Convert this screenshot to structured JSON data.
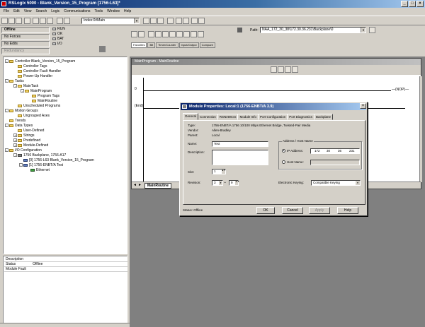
{
  "app": {
    "title": "RSLogix 5000 - Blank_Version_15_Program [1756-L63]*"
  },
  "menu": [
    "File",
    "Edit",
    "View",
    "Search",
    "Logic",
    "Communications",
    "Tools",
    "Window",
    "Help"
  ],
  "toolbar": {
    "routine_combo": "Index:0#Main",
    "path_label": "Path:",
    "path_value": "NAA_172_30_38\\172.30.36.231\\Backplane\\0"
  },
  "controller_status": {
    "mode": "Offline",
    "forces": "No Forces",
    "edits": "No Edits",
    "redundancy": "Redundancy",
    "leds": [
      "RUN",
      "OK",
      "BAT",
      "I/O"
    ]
  },
  "instruction_tabs": [
    "Favorites",
    "Bit",
    "Timer/Counter",
    "Input/Output",
    "Compare"
  ],
  "organizer": {
    "items": [
      {
        "label": "Controller Blank_Version_15_Program",
        "level": 0
      },
      {
        "label": "Controller Tags",
        "level": 1
      },
      {
        "label": "Controller Fault Handler",
        "level": 1
      },
      {
        "label": "Power-Up Handler",
        "level": 1
      },
      {
        "label": "Tasks",
        "level": 0
      },
      {
        "label": "MainTask",
        "level": 1
      },
      {
        "label": "MainProgram",
        "level": 2
      },
      {
        "label": "Program Tags",
        "level": 3
      },
      {
        "label": "MainRoutine",
        "level": 3
      },
      {
        "label": "Unscheduled Programs",
        "level": 1
      },
      {
        "label": "Motion Groups",
        "level": 0
      },
      {
        "label": "Ungrouped Axes",
        "level": 1
      },
      {
        "label": "Trends",
        "level": 0
      },
      {
        "label": "Data Types",
        "level": 0
      },
      {
        "label": "User-Defined",
        "level": 1
      },
      {
        "label": "Strings",
        "level": 1
      },
      {
        "label": "Predefined",
        "level": 1
      },
      {
        "label": "Module-Defined",
        "level": 1
      },
      {
        "label": "I/O Configuration",
        "level": 0
      },
      {
        "label": "1756 Backplane, 1756-A17",
        "level": 1
      },
      {
        "label": "[0] 1756-L63 Blank_Version_15_Program",
        "level": 2
      },
      {
        "label": "[1] 1756-ENBT/A Test",
        "level": 2
      },
      {
        "label": "Ethernet",
        "level": 3
      }
    ]
  },
  "description": {
    "header": "Description",
    "rows": [
      {
        "k": "Status",
        "v": "Offline"
      },
      {
        "k": "Module Fault",
        "v": ""
      }
    ]
  },
  "routine": {
    "title": "MainProgram - MainRoutine",
    "rung0": "0",
    "end": "(End)",
    "nop": "NOP",
    "tab": "MainRoutine"
  },
  "dialog": {
    "title": "Module Properties: Local:1 (1756-ENBT/A 3.9)",
    "tabs": [
      "General",
      "Connection",
      "RSNetWorx",
      "Module Info",
      "Port Configuration",
      "Port Diagnostics",
      "Backplane"
    ],
    "type_label": "Type:",
    "type_value": "1756-ENBT/A 1756 10/100 Mbps Ethernet Bridge, Twisted-Pair Media",
    "vendor_label": "Vendor:",
    "vendor_value": "Allen-Bradley",
    "parent_label": "Parent:",
    "parent_value": "Local",
    "name_label": "Name:",
    "name_value": "Test",
    "desc_label": "Description:",
    "slot_label": "Slot:",
    "slot_value": "1",
    "revision_label": "Revision:",
    "rev_major": "3",
    "rev_minor": "9",
    "addr_group": "Address / Host Name",
    "ip_label": "IP Address:",
    "ip": [
      "172",
      "30",
      "36",
      "231"
    ],
    "host_label": "Host Name:",
    "keying_label": "Electronic Keying:",
    "keying_value": "Compatible Keying",
    "status": "Status:  Offline",
    "ok": "OK",
    "cancel": "Cancel",
    "apply": "Apply",
    "help": "Help"
  }
}
